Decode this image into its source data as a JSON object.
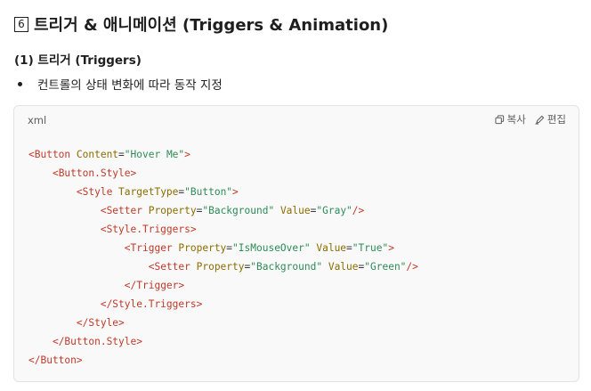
{
  "heading": {
    "number": "6",
    "title": "트리거 & 애니메이션 (Triggers & Animation)"
  },
  "subheading": "(1) 트리거 (Triggers)",
  "bullets": [
    "컨트롤의 상태 변화에 따라 동작 지정"
  ],
  "code_block": {
    "language": "xml",
    "copy_label": "복사",
    "edit_label": "편집",
    "icons": [
      "copy-icon",
      "edit-icon"
    ],
    "lines": [
      {
        "indent": 0,
        "tokens": [
          {
            "t": "<Button ",
            "k": "tag"
          },
          {
            "t": "Content",
            "k": "attr"
          },
          {
            "t": "=",
            "k": "punct"
          },
          {
            "t": "\"Hover Me\"",
            "k": "val"
          },
          {
            "t": ">",
            "k": "tag"
          }
        ]
      },
      {
        "indent": 1,
        "tokens": [
          {
            "t": "<Button.Style>",
            "k": "tag"
          }
        ]
      },
      {
        "indent": 2,
        "tokens": [
          {
            "t": "<Style ",
            "k": "tag"
          },
          {
            "t": "TargetType",
            "k": "attr"
          },
          {
            "t": "=",
            "k": "punct"
          },
          {
            "t": "\"Button\"",
            "k": "val"
          },
          {
            "t": ">",
            "k": "tag"
          }
        ]
      },
      {
        "indent": 3,
        "tokens": [
          {
            "t": "<Setter ",
            "k": "tag"
          },
          {
            "t": "Property",
            "k": "attr"
          },
          {
            "t": "=",
            "k": "punct"
          },
          {
            "t": "\"Background\"",
            "k": "val"
          },
          {
            "t": " ",
            "k": "punct"
          },
          {
            "t": "Value",
            "k": "attr"
          },
          {
            "t": "=",
            "k": "punct"
          },
          {
            "t": "\"Gray\"",
            "k": "val"
          },
          {
            "t": "/>",
            "k": "tag"
          }
        ]
      },
      {
        "indent": 3,
        "tokens": [
          {
            "t": "<Style.Triggers>",
            "k": "tag"
          }
        ]
      },
      {
        "indent": 4,
        "tokens": [
          {
            "t": "<Trigger ",
            "k": "tag"
          },
          {
            "t": "Property",
            "k": "attr"
          },
          {
            "t": "=",
            "k": "punct"
          },
          {
            "t": "\"IsMouseOver\"",
            "k": "val"
          },
          {
            "t": " ",
            "k": "punct"
          },
          {
            "t": "Value",
            "k": "attr"
          },
          {
            "t": "=",
            "k": "punct"
          },
          {
            "t": "\"True\"",
            "k": "val"
          },
          {
            "t": ">",
            "k": "tag"
          }
        ]
      },
      {
        "indent": 5,
        "tokens": [
          {
            "t": "<Setter ",
            "k": "tag"
          },
          {
            "t": "Property",
            "k": "attr"
          },
          {
            "t": "=",
            "k": "punct"
          },
          {
            "t": "\"Background\"",
            "k": "val"
          },
          {
            "t": " ",
            "k": "punct"
          },
          {
            "t": "Value",
            "k": "attr"
          },
          {
            "t": "=",
            "k": "punct"
          },
          {
            "t": "\"Green\"",
            "k": "val"
          },
          {
            "t": "/>",
            "k": "tag"
          }
        ]
      },
      {
        "indent": 4,
        "tokens": [
          {
            "t": "</Trigger>",
            "k": "tag"
          }
        ]
      },
      {
        "indent": 3,
        "tokens": [
          {
            "t": "</Style.Triggers>",
            "k": "tag"
          }
        ]
      },
      {
        "indent": 2,
        "tokens": [
          {
            "t": "</Style>",
            "k": "tag"
          }
        ]
      },
      {
        "indent": 1,
        "tokens": [
          {
            "t": "</Button.Style>",
            "k": "tag"
          }
        ]
      },
      {
        "indent": 0,
        "tokens": [
          {
            "t": "</Button>",
            "k": "tag"
          }
        ]
      }
    ]
  }
}
